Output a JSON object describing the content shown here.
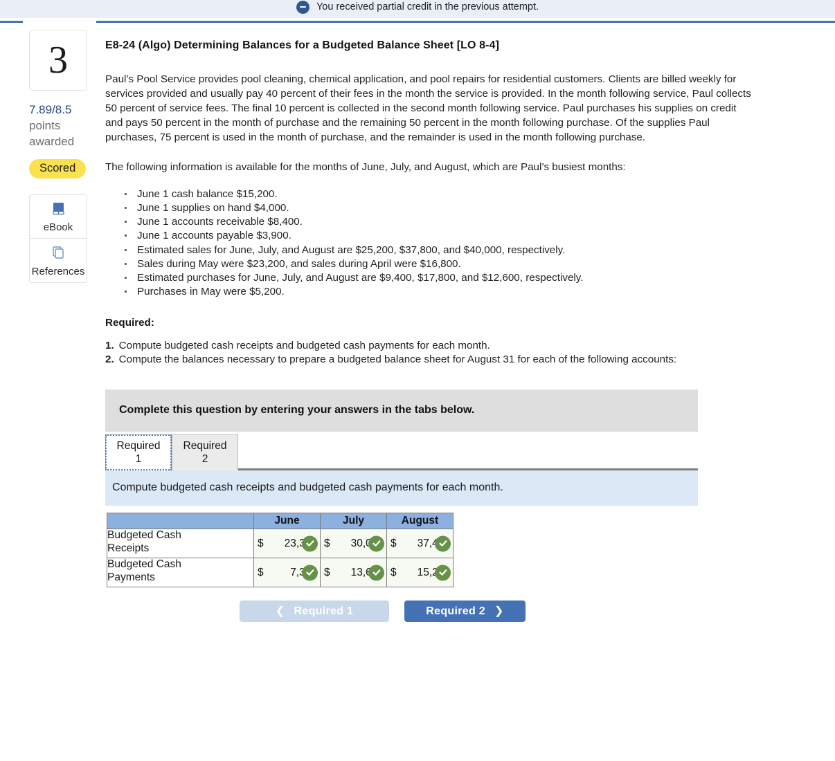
{
  "alert": {
    "icon": "minus-circle-icon",
    "message": "You received partial credit in the previous attempt."
  },
  "sidebar": {
    "question_number": "3",
    "points": "7.89/8.5",
    "points_label_line1": "points",
    "points_label_line2": "awarded",
    "status_badge": "Scored",
    "tools": [
      {
        "icon": "book-icon",
        "label": "eBook"
      },
      {
        "icon": "pages-icon",
        "label": "References"
      }
    ]
  },
  "question": {
    "title": "E8-24 (Algo) Determining Balances for a Budgeted Balance Sheet [LO 8-4]",
    "paragraph1": "Paul’s Pool Service provides pool cleaning, chemical application, and pool repairs for residential customers. Clients are billed weekly for services provided and usually pay 40 percent of their fees in the month the service is provided. In the month following service, Paul collects 50 percent of service fees. The final 10 percent is collected in the second month following service. Paul purchases his supplies on credit and pays 50 percent in the month of purchase and the remaining 50 percent in the month following purchase. Of the supplies Paul purchases, 75 percent is used in the month of purchase, and the remainder is used in the month following purchase.",
    "paragraph2": "The following information is available for the months of June, July, and August, which are Paul’s busiest months:",
    "facts": [
      "June 1 cash balance $15,200.",
      "June 1 supplies on hand $4,000.",
      "June 1 accounts receivable $8,400.",
      "June 1 accounts payable $3,900.",
      "Estimated sales for June, July, and August are $25,200, $37,800, and $40,000, respectively.",
      "Sales during May were $23,200, and sales during April were $16,800.",
      "Estimated purchases for June, July, and August are $9,400, $17,800, and $12,600, respectively.",
      "Purchases in May were $5,200."
    ],
    "required_label": "Required:",
    "requirements": [
      {
        "num": "1.",
        "text": "Compute budgeted cash receipts and budgeted cash payments for each month."
      },
      {
        "num": "2.",
        "text": "Compute the balances necessary to prepare a budgeted balance sheet for August 31 for each of the following accounts:"
      }
    ]
  },
  "widget": {
    "complete_bar": "Complete this question by entering your answers in the tabs below.",
    "tabs": [
      {
        "line1": "Required",
        "line2": "1",
        "active": true
      },
      {
        "line1": "Required",
        "line2": "2",
        "active": false
      }
    ],
    "prompt": "Compute budgeted cash receipts and budgeted cash payments for each month.",
    "table": {
      "corner_header": "",
      "columns": [
        "June",
        "July",
        "August"
      ],
      "rows": [
        {
          "label_line1": "Budgeted Cash",
          "label_line2": "Receipts",
          "currency": "$",
          "values": [
            "23,360",
            "30,040",
            "37,420"
          ],
          "status": [
            "correct",
            "correct",
            "correct"
          ]
        },
        {
          "label_line1": "Budgeted Cash",
          "label_line2": "Payments",
          "currency": "$",
          "values": [
            "7,300",
            "13,600",
            "15,200"
          ],
          "status": [
            "correct",
            "correct",
            "correct"
          ]
        }
      ]
    },
    "nav": {
      "prev_label": "Required 1",
      "next_label": "Required 2",
      "prev_icon": "chevron-left-icon",
      "next_icon": "chevron-right-icon",
      "prev_disabled": true
    }
  },
  "colors": {
    "alert_bg": "#eaeef7",
    "rule_blue": "#4572b5",
    "points_blue": "#29457e",
    "badge_yellow": "#fbe04f",
    "table_header_blue": "#8cb0e0",
    "prompt_blue": "#dbe9f7",
    "complete_gray": "#dedede",
    "check_green": "#669149",
    "btn_blue": "#4572b5",
    "btn_disabled": "#c8d7ea"
  }
}
